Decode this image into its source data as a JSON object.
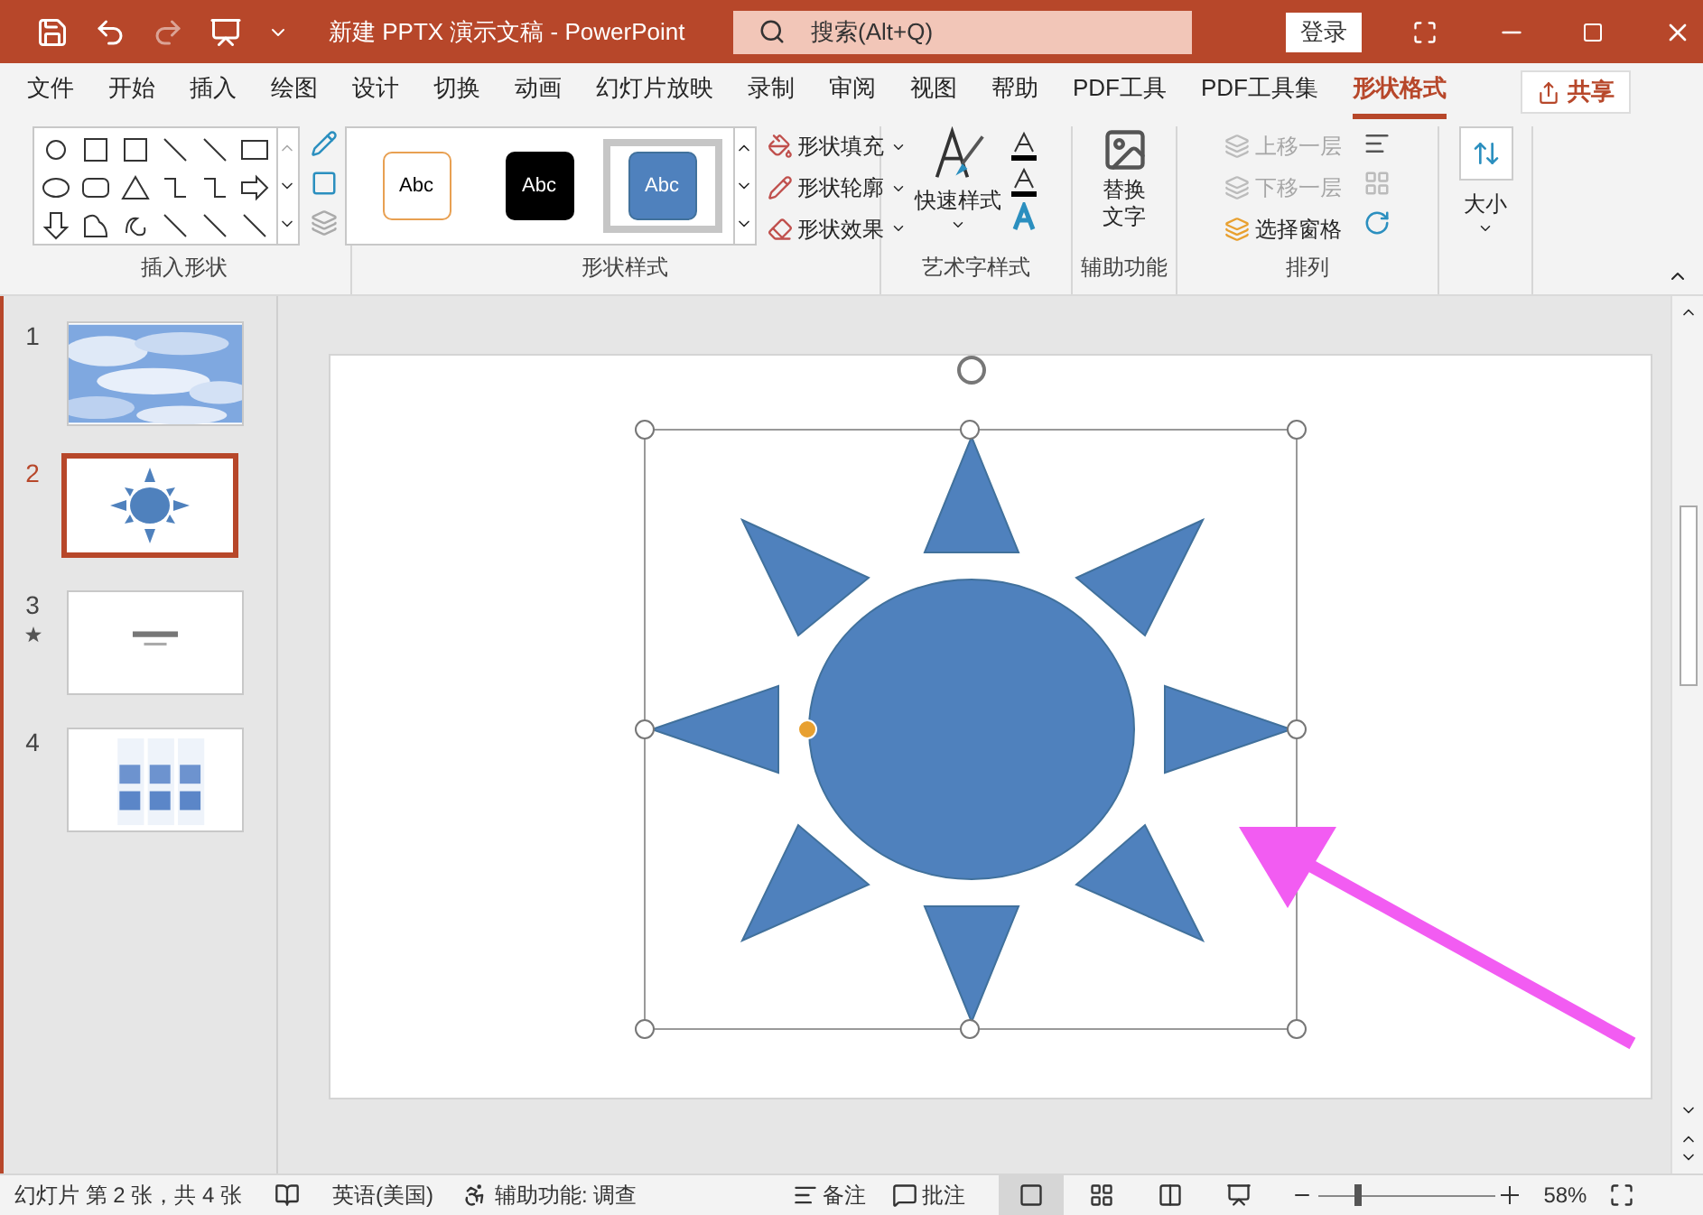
{
  "title_bar": {
    "title": "新建 PPTX 演示文稿  -  PowerPoint",
    "search": {
      "placeholder": "搜索(Alt+Q)"
    },
    "login_button": "登录"
  },
  "tabs": [
    {
      "label": "文件",
      "selected": false
    },
    {
      "label": "开始",
      "selected": false
    },
    {
      "label": "插入",
      "selected": false
    },
    {
      "label": "绘图",
      "selected": false
    },
    {
      "label": "设计",
      "selected": false
    },
    {
      "label": "切换",
      "selected": false
    },
    {
      "label": "动画",
      "selected": false
    },
    {
      "label": "幻灯片放映",
      "selected": false
    },
    {
      "label": "录制",
      "selected": false
    },
    {
      "label": "审阅",
      "selected": false
    },
    {
      "label": "视图",
      "selected": false
    },
    {
      "label": "帮助",
      "selected": false
    },
    {
      "label": "PDF工具",
      "selected": false
    },
    {
      "label": "PDF工具集",
      "selected": false
    },
    {
      "label": "形状格式",
      "selected": true
    }
  ],
  "share_button": "共享",
  "ribbon": {
    "insert_shapes": {
      "label": "插入形状"
    },
    "shape_styles": {
      "label": "形状样式",
      "samples": [
        {
          "text": "Abc",
          "kind": "outline",
          "selected": false
        },
        {
          "text": "Abc",
          "kind": "dark",
          "selected": false
        },
        {
          "text": "Abc",
          "kind": "blue",
          "selected": true
        }
      ],
      "commands": [
        "形状填充",
        "形状轮廓",
        "形状效果"
      ]
    },
    "wordart": {
      "label": "艺术字样式",
      "quick_styles": "快速样式"
    },
    "accessibility": {
      "label": "辅助功能",
      "alt_text": "替换文字"
    },
    "arrange": {
      "label": "排列",
      "items": [
        {
          "label": "上移一层",
          "disabled": true
        },
        {
          "label": "下移一层",
          "disabled": true
        },
        {
          "label": "选择窗格",
          "disabled": false
        }
      ]
    },
    "size": {
      "label": "大小"
    }
  },
  "slides": [
    {
      "number": "1",
      "selected": false,
      "animated": false,
      "kind": "picture"
    },
    {
      "number": "2",
      "selected": true,
      "animated": false,
      "kind": "sun"
    },
    {
      "number": "3",
      "selected": false,
      "animated": true,
      "kind": "title"
    },
    {
      "number": "4",
      "selected": false,
      "animated": false,
      "kind": "grid"
    }
  ],
  "status_bar": {
    "slide_info": "幻灯片 第 2 张，共 4 张",
    "language": "英语(美国)",
    "accessibility": "辅助功能: 调查",
    "notes": "备注",
    "comments": "批注",
    "zoom": "58%",
    "zoom_slider": {
      "level": 0.22
    }
  }
}
